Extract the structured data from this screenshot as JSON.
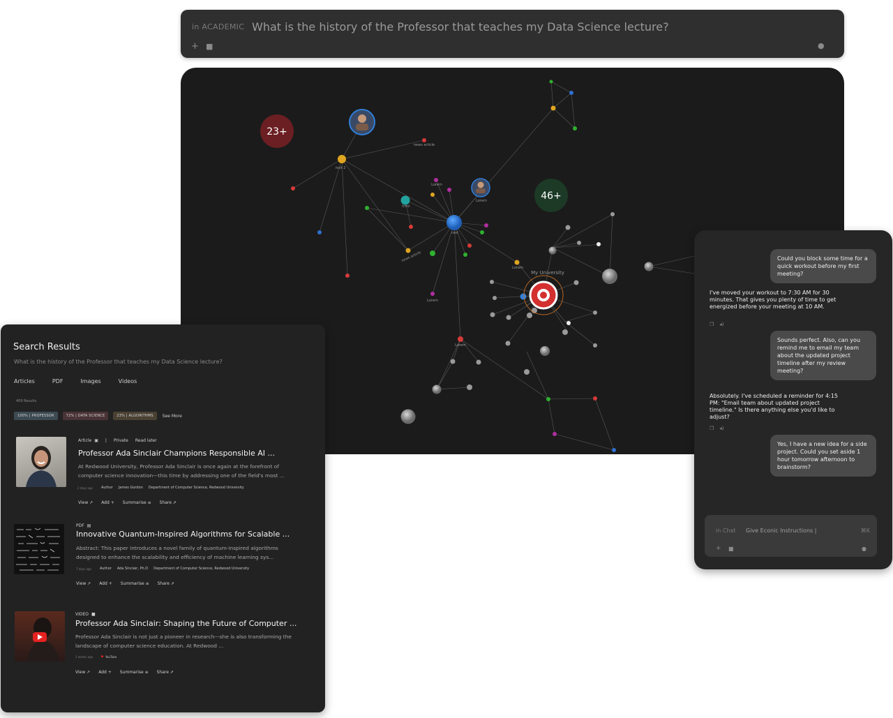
{
  "top_search": {
    "scope": "in ACADEMIC",
    "query": "What is the history of the Professor that teaches my Data Science lecture?"
  },
  "graph": {
    "count_a": "23+",
    "count_b": "46+",
    "labels": {
      "root2": "root 2",
      "news1": "news article",
      "news2": "news article",
      "html": "html",
      "lorem1": "Lorem",
      "lorem2": "Lorem",
      "lorem3": "Lorem",
      "lorem4": "Lorem",
      "lorem5": "Lorem",
      "root": "root",
      "myuni": "My University"
    }
  },
  "results": {
    "title": "Search Results",
    "query": "What is the history of the Professor that teaches my Data Science lecture?",
    "tabs": [
      "Articles",
      "PDF",
      "Images",
      "Videos"
    ],
    "count": "409 Results",
    "chips": [
      "100% | PROFESSOR",
      "72% | DATA SCIENCE",
      "23% | ALGORITHMS"
    ],
    "see_more": "See More",
    "items": [
      {
        "type": "Article",
        "privacy": "Private",
        "read_later": "Read later",
        "title": "Professor Ada Sinclair Champions Responsible AI ...",
        "desc": "At Redwood University, Professor Ada Sinclair is once again at the forefront of computer science innovation—this time by addressing one of the field's most ...",
        "ago": "2 days ago",
        "author_label": "Author",
        "author": "James Gordon",
        "dept": "Department of Computer Science, Redwood University",
        "actions": [
          "View ↗",
          "Add +",
          "Summarise ≡",
          "Share ⇗"
        ]
      },
      {
        "type": "PDF",
        "title": "Innovative Quantum-Inspired Algorithms for Scalable ...",
        "desc": "Abstract: This paper introduces a novel family of quantum-inspired algorithms designed to enhance the scalability and efficiency of machine learning sys...",
        "ago": "7 days ago",
        "author_label": "Author",
        "author": "Ada Sinclair, Ph.D",
        "dept": "Department of Computer Science, Redwood University",
        "actions": [
          "View ↗",
          "Add +",
          "Summarise ≡",
          "Share ⇗"
        ]
      },
      {
        "type": "VIDEO",
        "title": "Professor Ada Sinclair: Shaping the Future of Computer ...",
        "desc": "Professor Ada Sinclair is not just a pioneer in research—she is also transforming the landscape of computer science education. At Redwood ...",
        "ago": "3 weeks ago",
        "source": "YouTube",
        "actions": [
          "View ↗",
          "Add +",
          "Summarise ≡",
          "Share ⇗"
        ]
      }
    ]
  },
  "chat": {
    "messages": [
      {
        "role": "user",
        "text": "Could you block some time for a quick workout before my first meeting?"
      },
      {
        "role": "assistant",
        "text": "I've moved your workout to 7:30 AM for 30 minutes. That gives you plenty of time to get energized before your meeting at 10 AM."
      },
      {
        "role": "user",
        "text": "Sounds perfect. Also, can you remind me to email my team about the updated project timeline after my review meeting?"
      },
      {
        "role": "assistant",
        "text": "Absolutely. I've scheduled a reminder for 4:15 PM: \"Email team about updated project timeline.\" Is there anything else you'd like to adjust?"
      },
      {
        "role": "user",
        "text": "Yes, I have a new idea for a side project. Could you set aside 1 hour tomorrow afternoon to brainstorm?"
      }
    ],
    "input_scope": "in Chat",
    "input_value": "Give Econic Instructions |",
    "shortcut": "⌘K"
  },
  "colors": {
    "red_badge": "#6b1f22",
    "green_badge": "#1c3a26",
    "accent_blue": "#2f7fd8",
    "accent_orange": "#e07a2a"
  }
}
